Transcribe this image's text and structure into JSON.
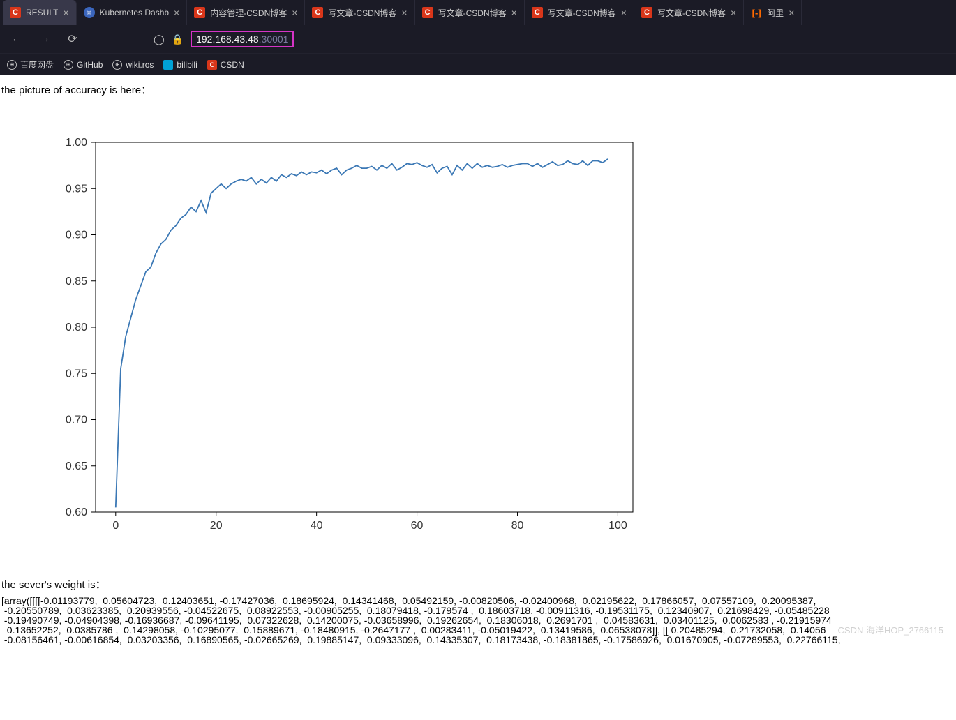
{
  "tabs": [
    {
      "kind": "c",
      "label": "RESULT",
      "active": true
    },
    {
      "kind": "k",
      "label": "Kubernetes Dashb",
      "active": false
    },
    {
      "kind": "c",
      "label": "内容管理-CSDN博客",
      "active": false
    },
    {
      "kind": "c",
      "label": "写文章-CSDN博客",
      "active": false
    },
    {
      "kind": "c",
      "label": "写文章-CSDN博客",
      "active": false
    },
    {
      "kind": "c",
      "label": "写文章-CSDN博客",
      "active": false
    },
    {
      "kind": "c",
      "label": "写文章-CSDN博客",
      "active": false
    },
    {
      "kind": "a",
      "label": "阿里",
      "active": false
    }
  ],
  "url": {
    "host": "192.168.43.48",
    "port": ":30001"
  },
  "bookmarks": [
    {
      "icon": "globe",
      "label": "百度网盘"
    },
    {
      "icon": "globe",
      "label": "GitHub"
    },
    {
      "icon": "globe",
      "label": "wiki.ros"
    },
    {
      "icon": "bili",
      "label": "bilibili"
    },
    {
      "icon": "csdn",
      "label": "CSDN"
    }
  ],
  "page": {
    "accuracy_heading": "the picture of accuracy is here：",
    "weight_heading": "the sever's weight is：",
    "watermark": "CSDN 海洋HOP_2766115"
  },
  "chart_data": {
    "type": "line",
    "xlabel": "",
    "ylabel": "",
    "xlim": [
      -4,
      103
    ],
    "ylim": [
      0.6,
      1.0
    ],
    "xticks": [
      0,
      20,
      40,
      60,
      80,
      100
    ],
    "yticks": [
      0.6,
      0.65,
      0.7,
      0.75,
      0.8,
      0.85,
      0.9,
      0.95,
      1.0
    ],
    "series": [
      {
        "name": "accuracy",
        "color": "#3b78b5",
        "x": [
          0,
          1,
          2,
          3,
          4,
          5,
          6,
          7,
          8,
          9,
          10,
          11,
          12,
          13,
          14,
          15,
          16,
          17,
          18,
          19,
          20,
          21,
          22,
          23,
          24,
          25,
          26,
          27,
          28,
          29,
          30,
          31,
          32,
          33,
          34,
          35,
          36,
          37,
          38,
          39,
          40,
          41,
          42,
          43,
          44,
          45,
          46,
          47,
          48,
          49,
          50,
          51,
          52,
          53,
          54,
          55,
          56,
          57,
          58,
          59,
          60,
          61,
          62,
          63,
          64,
          65,
          66,
          67,
          68,
          69,
          70,
          71,
          72,
          73,
          74,
          75,
          76,
          77,
          78,
          79,
          80,
          81,
          82,
          83,
          84,
          85,
          86,
          87,
          88,
          89,
          90,
          91,
          92,
          93,
          94,
          95,
          96,
          97,
          98
        ],
        "y": [
          0.605,
          0.755,
          0.79,
          0.81,
          0.83,
          0.845,
          0.86,
          0.865,
          0.88,
          0.89,
          0.895,
          0.905,
          0.91,
          0.918,
          0.922,
          0.93,
          0.925,
          0.937,
          0.924,
          0.945,
          0.95,
          0.955,
          0.95,
          0.955,
          0.958,
          0.96,
          0.958,
          0.962,
          0.955,
          0.96,
          0.956,
          0.962,
          0.958,
          0.965,
          0.962,
          0.966,
          0.964,
          0.968,
          0.965,
          0.968,
          0.967,
          0.97,
          0.966,
          0.97,
          0.972,
          0.965,
          0.97,
          0.972,
          0.975,
          0.972,
          0.972,
          0.974,
          0.97,
          0.975,
          0.972,
          0.977,
          0.97,
          0.973,
          0.977,
          0.976,
          0.978,
          0.975,
          0.973,
          0.976,
          0.967,
          0.972,
          0.974,
          0.965,
          0.975,
          0.97,
          0.977,
          0.972,
          0.977,
          0.973,
          0.975,
          0.973,
          0.974,
          0.976,
          0.973,
          0.975,
          0.976,
          0.977,
          0.977,
          0.974,
          0.977,
          0.973,
          0.976,
          0.979,
          0.975,
          0.976,
          0.98,
          0.977,
          0.976,
          0.98,
          0.975,
          0.98,
          0.98,
          0.978,
          0.982
        ]
      }
    ]
  },
  "array_dump": {
    "lines": [
      "[array([[[[-0.01193779,  0.05604723,  0.12403651, -0.17427036,  0.18695924,  0.14341468,  0.05492159, -0.00820506, -0.02400968,  0.02195622,  0.17866057,  0.07557109,  0.20095387, ",
      " -0.20550789,  0.03623385,  0.20939556, -0.04522675,  0.08922553, -0.00905255,  0.18079418, -0.179574 ,  0.18603718, -0.00911316, -0.19531175,  0.12340907,  0.21698429, -0.05485228",
      " -0.19490749, -0.04904398, -0.16936687, -0.09641195,  0.07322628,  0.14200075, -0.03658996,  0.19262654,  0.18306018,  0.2691701 ,  0.04583631,  0.03401125,  0.0062583 , -0.21915974",
      "  0.13652252,  0.0385786 ,  0.14298058, -0.10295077,  0.15889671, -0.18480915, -0.2647177 ,  0.00283411, -0.05019422,  0.13419586,  0.06538078]], [[ 0.20485294,  0.21732058,  0.14056",
      " -0.08156461, -0.00616854,  0.03203356,  0.16890565, -0.02665269,  0.19885147,  0.09333096,  0.14335307,  0.18173438, -0.18381865, -0.17586926,  0.01670905, -0.07289553,  0.22766115,"
    ]
  }
}
